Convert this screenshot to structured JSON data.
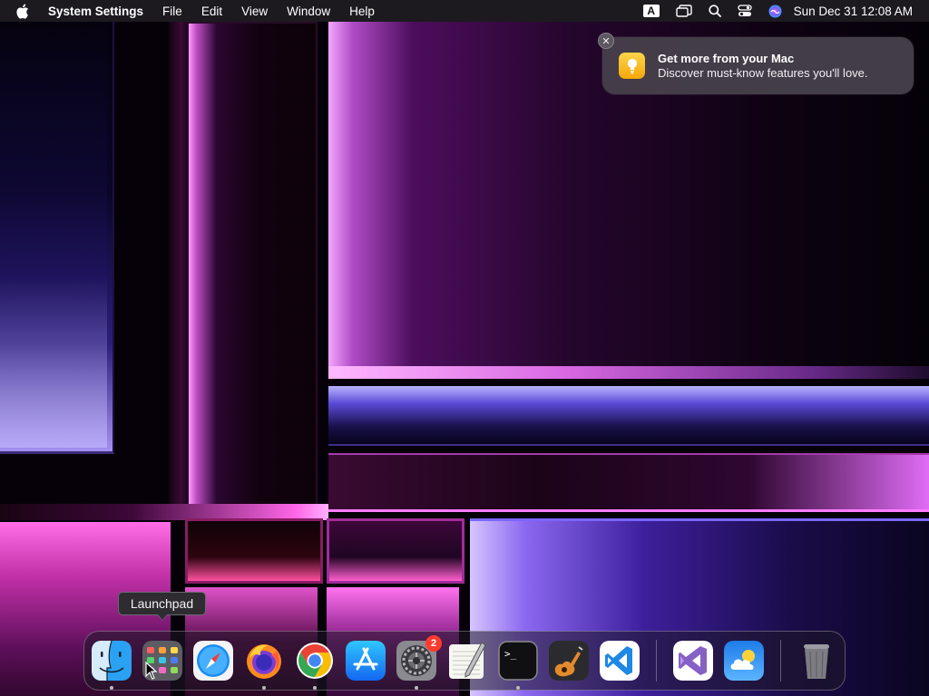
{
  "menubar": {
    "app_name": "System Settings",
    "menus": [
      "File",
      "Edit",
      "View",
      "Window",
      "Help"
    ],
    "input_source": "A",
    "clock": "Sun Dec 31  12:08 AM"
  },
  "notification": {
    "title": "Get more from your Mac",
    "body": "Discover must-know features you'll love."
  },
  "tooltip": {
    "text": "Launchpad"
  },
  "dock": {
    "items": [
      {
        "name": "Finder",
        "icon": "finder-icon",
        "running": true
      },
      {
        "name": "Launchpad",
        "icon": "launchpad-icon",
        "running": false
      },
      {
        "name": "Safari",
        "icon": "safari-icon",
        "running": false
      },
      {
        "name": "Firefox",
        "icon": "firefox-icon",
        "running": true
      },
      {
        "name": "Google Chrome",
        "icon": "chrome-icon",
        "running": true
      },
      {
        "name": "App Store",
        "icon": "app-store-icon",
        "running": false
      },
      {
        "name": "System Settings",
        "icon": "system-settings-icon",
        "running": true,
        "badge": "2"
      },
      {
        "name": "TextEdit",
        "icon": "textedit-icon",
        "running": false
      },
      {
        "name": "Terminal",
        "icon": "terminal-icon",
        "running": true
      },
      {
        "name": "GarageBand",
        "icon": "garageband-icon",
        "running": false
      },
      {
        "name": "Visual Studio Code",
        "icon": "vscode-icon",
        "running": false
      },
      {
        "name": "Visual Studio",
        "icon": "visual-studio-icon",
        "running": false
      },
      {
        "name": "Weather",
        "icon": "weather-icon",
        "running": false
      },
      {
        "name": "Trash",
        "icon": "trash-icon",
        "running": false
      }
    ]
  },
  "colors": {
    "badge": "#ff3b30",
    "notification_icon": "#f5b70d"
  }
}
